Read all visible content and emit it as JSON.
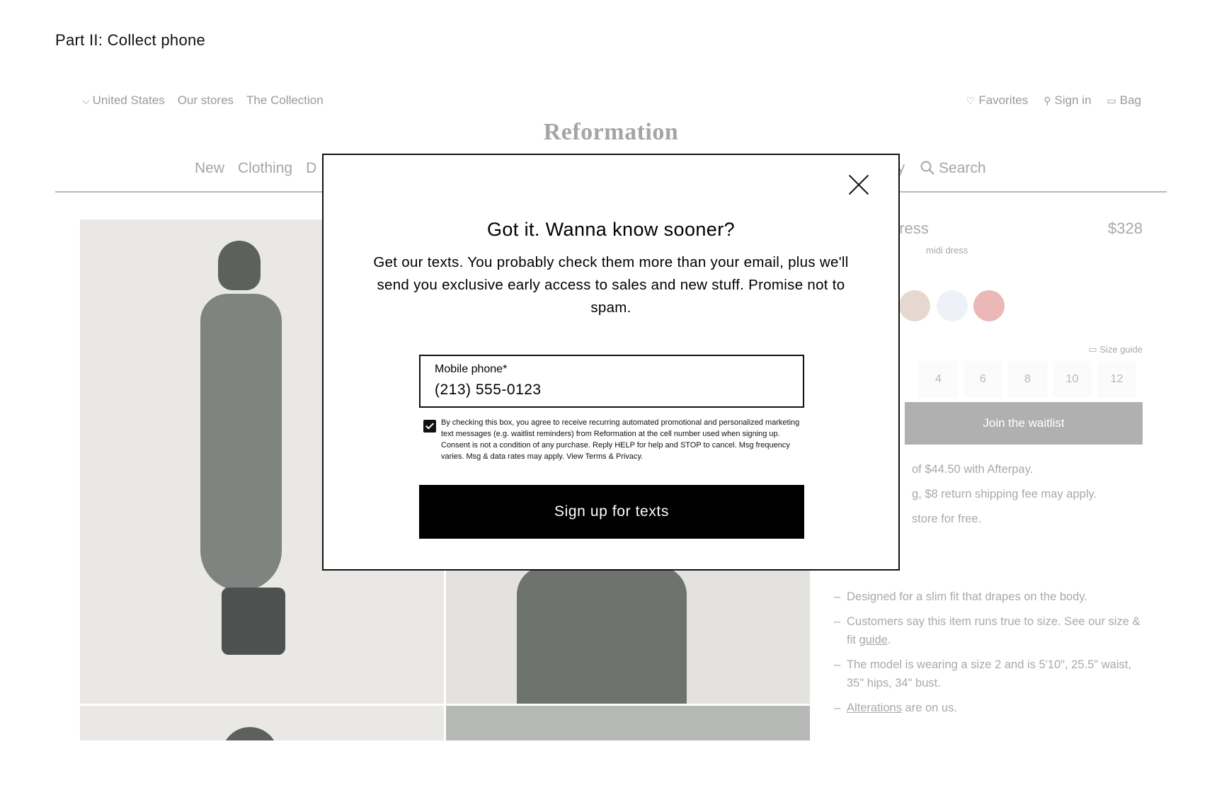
{
  "heading": "Part II: Collect phone",
  "site": {
    "utility_left": {
      "country": "United States",
      "stores": "Our stores",
      "collection": "The Collection"
    },
    "utility_right": {
      "favorites": "Favorites",
      "sign_in": "Sign in",
      "bag": "Bag"
    },
    "brand": "Reformation",
    "nav_left": [
      "New",
      "Clothing",
      "D"
    ],
    "nav_right": [
      "bility",
      "Search"
    ]
  },
  "product": {
    "name": "dress",
    "price": "$328",
    "subtitle": "midi dress",
    "swatch_colors": [
      "#e6d8ce",
      "#eef2f8",
      "#eab8b6"
    ],
    "size_guide": "Size guide",
    "sizes": [
      "4",
      "6",
      "8",
      "10",
      "12"
    ],
    "waitlist": "Join the waitlist",
    "afterpay": "of $44.50 with Afterpay.",
    "shipping": "g, $8 return shipping fee may apply.",
    "store": "store for free.",
    "bullets": {
      "fit": "Designed for a slim fit that drapes on the body.",
      "size_note": "Customers say this item runs true to size. See our size & fit",
      "size_link": "guide",
      "size_end": ".",
      "model": "The model is wearing a size 2 and is 5'10\", 25.5\" waist, 35\" hips, 34\" bust.",
      "alterations_link": "Alterations",
      "alterations_rest": " are on us."
    }
  },
  "modal": {
    "title": "Got it. Wanna know sooner?",
    "body": "Get our texts. You probably check them more than your email, plus we'll send you exclusive early access to sales and new stuff. Promise not to spam.",
    "phone_label": "Mobile phone*",
    "phone_value": "(213) 555-0123",
    "consent_checked": true,
    "consent": "By checking this box, you agree to receive recurring automated promotional and personalized marketing text messages (e.g. waitlist reminders) from Reformation at the cell number used when signing up. Consent is not a condition of any purchase. Reply HELP for help and STOP to cancel. Msg frequency varies. Msg & data rates may apply. View Terms & Privacy.",
    "cta": "Sign up for texts"
  }
}
